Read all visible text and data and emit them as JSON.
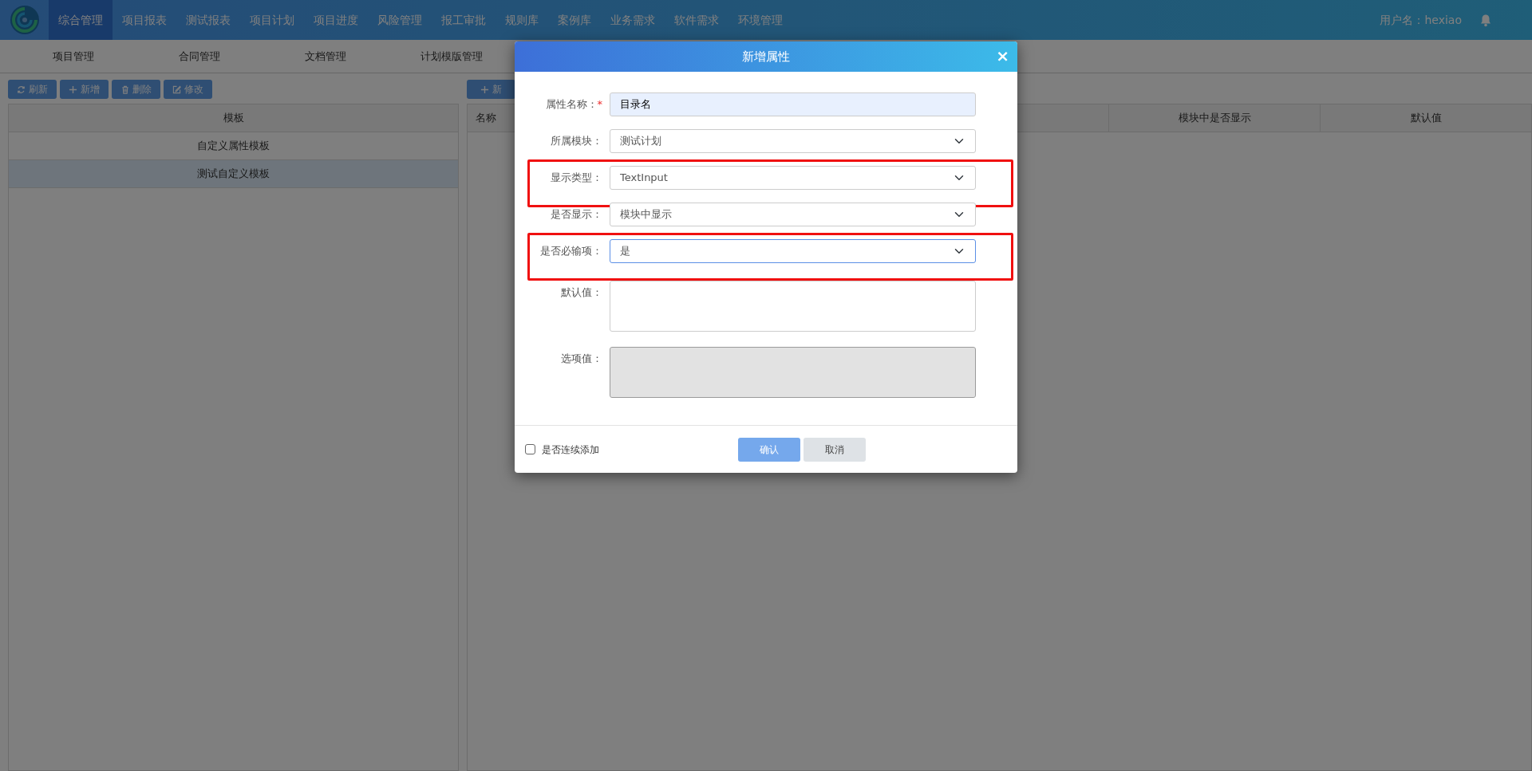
{
  "nav": {
    "items": [
      {
        "label": "综合管理",
        "selected": true
      },
      {
        "label": "项目报表",
        "selected": false
      },
      {
        "label": "测试报表",
        "selected": false
      },
      {
        "label": "项目计划",
        "selected": false
      },
      {
        "label": "项目进度",
        "selected": false
      },
      {
        "label": "风险管理",
        "selected": false
      },
      {
        "label": "报工审批",
        "selected": false
      },
      {
        "label": "规则库",
        "selected": false
      },
      {
        "label": "案例库",
        "selected": false
      },
      {
        "label": "业务需求",
        "selected": false
      },
      {
        "label": "软件需求",
        "selected": false
      },
      {
        "label": "环境管理",
        "selected": false
      }
    ],
    "user_label": "用户名：hexiao"
  },
  "subnav": {
    "items": [
      "项目管理",
      "合同管理",
      "文档管理",
      "计划模版管理"
    ]
  },
  "left_panel": {
    "toolbar": [
      {
        "label": "刷新",
        "kind": "refresh"
      },
      {
        "label": "新增",
        "kind": "add"
      },
      {
        "label": "删除",
        "kind": "delete"
      },
      {
        "label": "修改",
        "kind": "edit"
      }
    ],
    "table": {
      "columns": [
        "模板"
      ],
      "rows": [
        {
          "cells": [
            "自定义属性模板"
          ],
          "selected": false
        },
        {
          "cells": [
            "测试自定义模板"
          ],
          "selected": true
        }
      ]
    }
  },
  "right_panel": {
    "toolbar": [
      {
        "label": "新",
        "kind": "add"
      }
    ],
    "table": {
      "columns": [
        "名称",
        "模块中是否显示",
        "默认值"
      ]
    }
  },
  "dialog": {
    "title": "新增属性",
    "close": "×",
    "fields": [
      {
        "kind": "text",
        "label": "属性名称：",
        "required_mark": "*",
        "value": "目录名",
        "autofilled": true,
        "focused": false,
        "disabled": false,
        "highlighted": false
      },
      {
        "kind": "select",
        "label": "所属模块：",
        "value": "测试计划",
        "autofilled": false,
        "focused": false,
        "disabled": false,
        "highlighted": false
      },
      {
        "kind": "select",
        "label": "显示类型：",
        "value": "TextInput",
        "autofilled": false,
        "focused": false,
        "disabled": false,
        "highlighted": true
      },
      {
        "kind": "select",
        "label": "是否显示：",
        "value": "模块中显示",
        "autofilled": false,
        "focused": false,
        "disabled": false,
        "highlighted": false
      },
      {
        "kind": "select",
        "label": "是否必输项：",
        "value": "是",
        "autofilled": false,
        "focused": true,
        "disabled": false,
        "highlighted": true
      },
      {
        "kind": "textarea",
        "label": "默认值：",
        "autofilled": false,
        "focused": false,
        "disabled": false,
        "highlighted": false
      },
      {
        "kind": "textarea",
        "label": "选项值：",
        "autofilled": false,
        "focused": false,
        "disabled": true,
        "highlighted": false
      }
    ],
    "footer": {
      "continuous": {
        "label": "是否连续添加",
        "checked": false
      },
      "buttons": [
        {
          "label": "确认",
          "kind": "primary"
        },
        {
          "label": "取消",
          "kind": "secondary"
        }
      ]
    }
  }
}
